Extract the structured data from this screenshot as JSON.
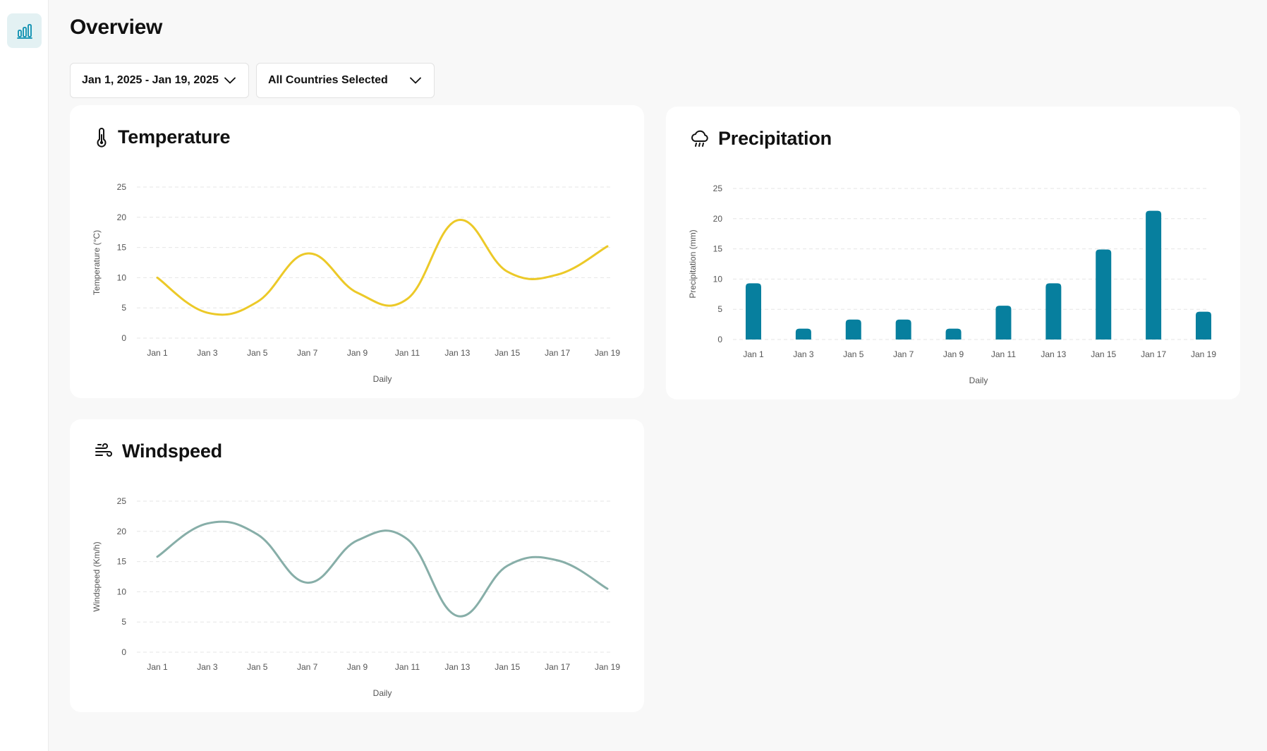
{
  "page": {
    "title": "Overview"
  },
  "sidebar": {
    "items": [
      {
        "icon": "bar-chart-icon"
      }
    ]
  },
  "filters": {
    "date_range": "Jan 1, 2025 - Jan 19, 2025",
    "countries": "All Countries Selected"
  },
  "colors": {
    "accent": "#0a7fa0",
    "temperature_line": "#ecc928",
    "precipitation_bar": "#077f9e",
    "windspeed_line": "#87aea8",
    "grid": "#e6e6e6"
  },
  "cards": {
    "temperature": {
      "title": "Temperature",
      "icon": "thermometer-icon"
    },
    "precipitation": {
      "title": "Precipitation",
      "icon": "cloud-rain-icon"
    },
    "windspeed": {
      "title": "Windspeed",
      "icon": "wind-icon"
    }
  },
  "chart_data": [
    {
      "id": "temperature",
      "type": "line",
      "title": "Temperature",
      "xlabel": "Daily",
      "ylabel": "Temperature (°C)",
      "ylim": [
        0,
        25
      ],
      "yticks": [
        0,
        5,
        10,
        15,
        20,
        25
      ],
      "grid": true,
      "x_labels": [
        "Jan 1",
        "Jan 3",
        "Jan 5",
        "Jan 7",
        "Jan 9",
        "Jan 11",
        "Jan 13",
        "Jan 15",
        "Jan 17",
        "Jan 19"
      ],
      "series": [
        {
          "values": [
            10,
            4.2,
            6,
            14,
            7.5,
            6.5,
            19.5,
            11,
            10.5,
            15.2
          ]
        }
      ]
    },
    {
      "id": "precipitation",
      "type": "bar",
      "title": "Precipitation",
      "xlabel": "Daily",
      "ylabel": "Precipitation (mm)",
      "ylim": [
        0,
        25
      ],
      "yticks": [
        0,
        5,
        10,
        15,
        20,
        25
      ],
      "grid": true,
      "categories": [
        "Jan 1",
        "Jan 3",
        "Jan 5",
        "Jan 7",
        "Jan 9",
        "Jan 11",
        "Jan 13",
        "Jan 15",
        "Jan 17",
        "Jan 19"
      ],
      "values": [
        9.3,
        1.8,
        3.3,
        3.3,
        1.8,
        5.6,
        9.3,
        14.9,
        21.3,
        4.6
      ]
    },
    {
      "id": "windspeed",
      "type": "line",
      "title": "Windspeed",
      "xlabel": "Daily",
      "ylabel": "Windspeed (Km/h)",
      "ylim": [
        0,
        25
      ],
      "yticks": [
        0,
        5,
        10,
        15,
        20,
        25
      ],
      "grid": true,
      "x_labels": [
        "Jan 1",
        "Jan 3",
        "Jan 5",
        "Jan 7",
        "Jan 9",
        "Jan 11",
        "Jan 13",
        "Jan 15",
        "Jan 17",
        "Jan 19"
      ],
      "series": [
        {
          "values": [
            15.8,
            21.3,
            19.5,
            11.5,
            18.5,
            18.7,
            6.0,
            14.3,
            15.2,
            10.5
          ]
        }
      ]
    }
  ]
}
